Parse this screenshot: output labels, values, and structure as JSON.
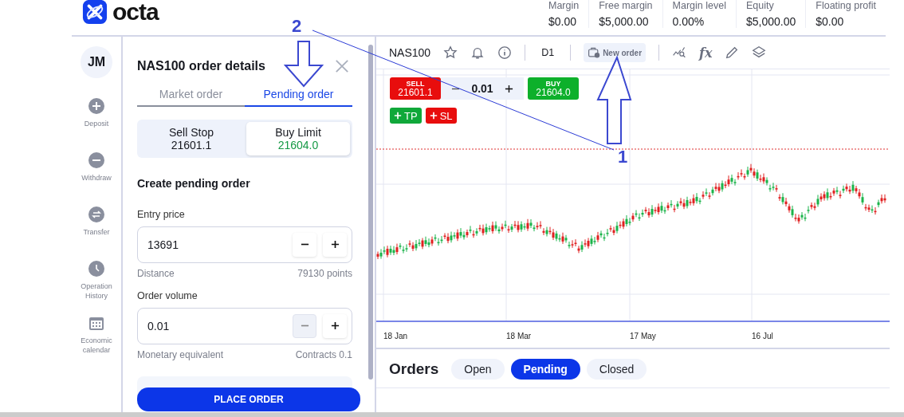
{
  "brand": {
    "name": "octa"
  },
  "account_summary": [
    {
      "label": "Margin",
      "value": "$0.00"
    },
    {
      "label": "Free margin",
      "value": "$5,000.00"
    },
    {
      "label": "Margin level",
      "value": "0.00%"
    },
    {
      "label": "Equity",
      "value": "$5,000.00"
    },
    {
      "label": "Floating profit",
      "value": "$0.00"
    }
  ],
  "user": {
    "initials": "JM"
  },
  "sidebar": {
    "items": [
      {
        "label": "Deposit",
        "kind": "deposit"
      },
      {
        "label": "Withdraw",
        "kind": "withdraw"
      },
      {
        "label": "Transfer",
        "kind": "transfer"
      },
      {
        "label": "Operation History",
        "kind": "history"
      },
      {
        "label": "Economic calendar",
        "kind": "calendar"
      }
    ]
  },
  "order_panel": {
    "title": "NAS100 order details",
    "tabs": [
      {
        "label": "Market order",
        "selected": false
      },
      {
        "label": "Pending order",
        "selected": true
      }
    ],
    "order_types": [
      {
        "label": "Sell Stop",
        "price": "21601.1",
        "selected": false
      },
      {
        "label": "Buy Limit",
        "price": "21604.0",
        "selected": true
      }
    ],
    "section_title": "Create pending order",
    "fields": [
      {
        "label": "Entry price",
        "value": "13691",
        "decrease_disabled": false,
        "note_label": "Distance",
        "note_value": "79130 points"
      },
      {
        "label": "Order volume",
        "value": "0.01",
        "decrease_disabled": true,
        "note_label": "Monetary equivalent",
        "note_value": "Contracts 0.1"
      }
    ],
    "submit": "PLACE ORDER"
  },
  "chart": {
    "symbol": "NAS100",
    "timeframe": "D1",
    "new_order": "New order",
    "formula": "fx",
    "sell": {
      "label": "SELL",
      "price": "21601.1"
    },
    "volume": "0.01",
    "buy": {
      "label": "BUY",
      "price": "21604.0"
    },
    "take_profit": "TP",
    "stop_loss": "SL",
    "x_labels": [
      "18 Jan",
      "18 Mar",
      "17 May",
      "16 Jul"
    ]
  },
  "orders": {
    "title": "Orders",
    "filters": [
      {
        "label": "Open",
        "selected": false
      },
      {
        "label": "Pending",
        "selected": true
      },
      {
        "label": "Closed",
        "selected": false
      }
    ]
  },
  "annotations": [
    {
      "label": "1"
    },
    {
      "label": "2"
    }
  ]
}
